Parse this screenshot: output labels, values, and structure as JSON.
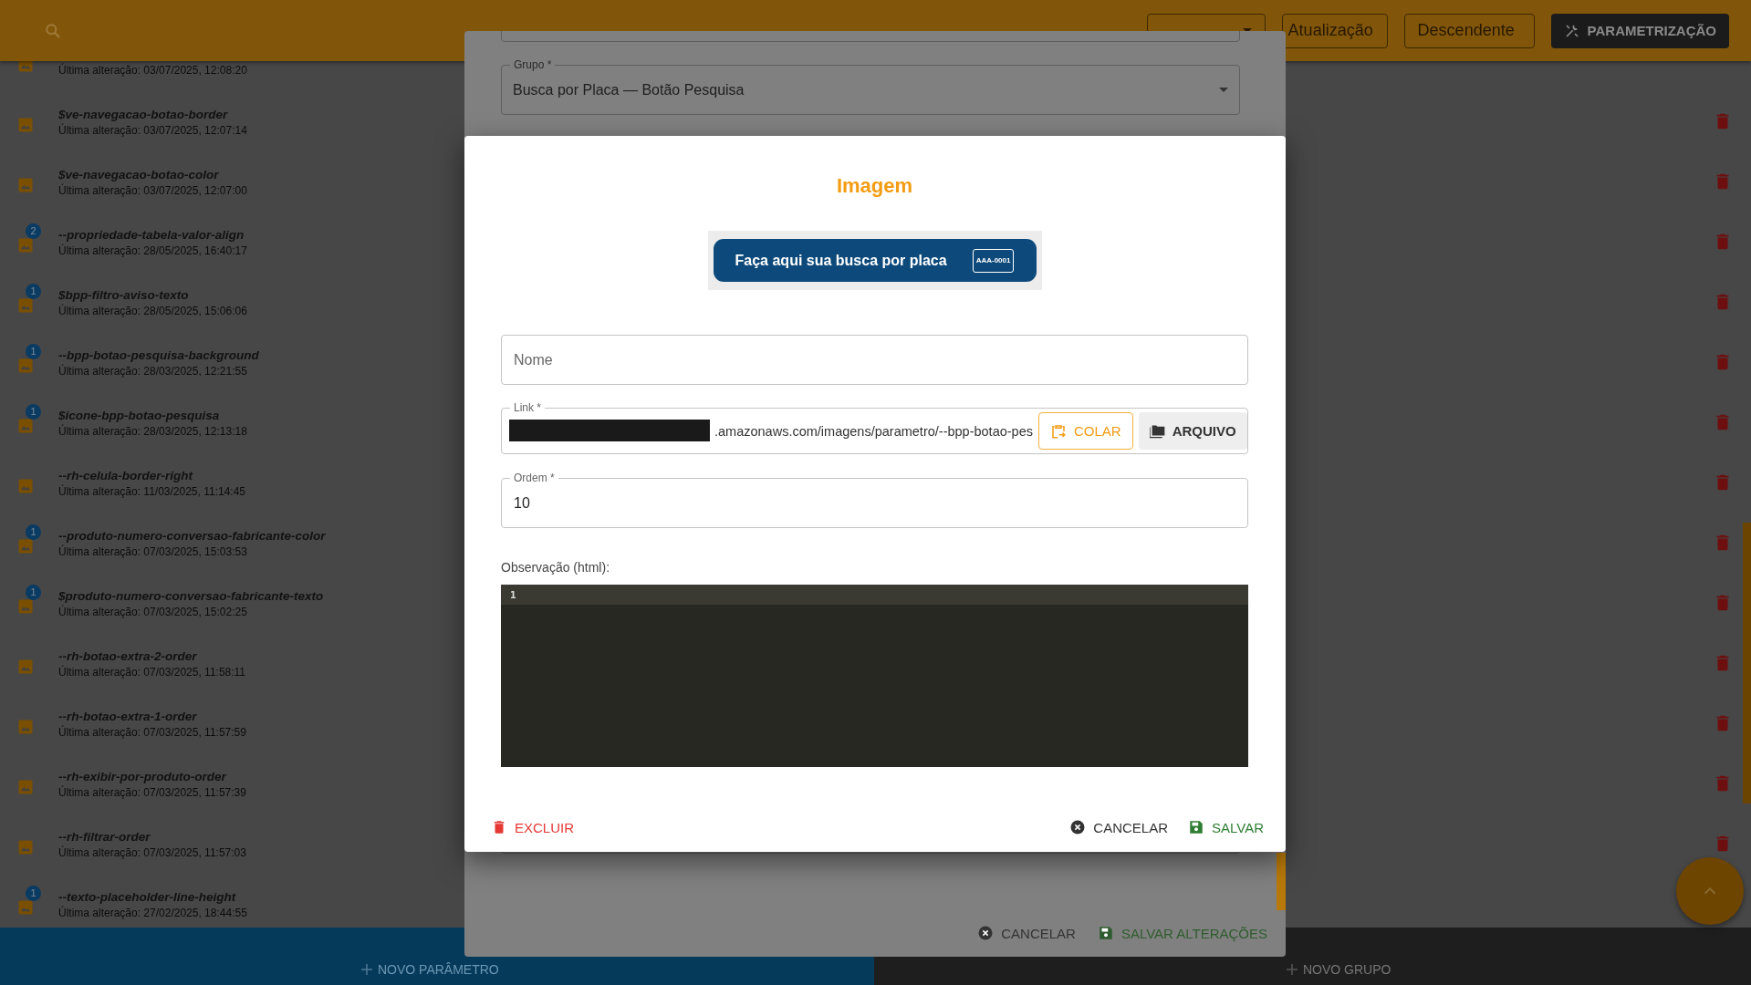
{
  "top_bar": {
    "filters": [
      {
        "value": "Atualização"
      },
      {
        "value": "Descendente"
      }
    ],
    "settings_button": "PARAMETRIZAÇÃO"
  },
  "parameters": [
    {
      "modified": "Última alteração: 03/07/2025, 12:08:20"
    },
    {
      "name": "$ve-navegacao-botao-border",
      "modified": "Última alteração: 03/07/2025, 12:07:14"
    },
    {
      "name": "$ve-navegacao-botao-color",
      "modified": "Última alteração: 03/07/2025, 12:07:00"
    },
    {
      "name": "--propriedade-tabela-valor-align",
      "modified": "Última alteração: 28/05/2025, 16:40:17",
      "badge": "2"
    },
    {
      "name": "$bpp-filtro-aviso-texto",
      "modified": "Última alteração: 28/05/2025, 15:06:06",
      "badge": "1"
    },
    {
      "name": "--bpp-botao-pesquisa-background",
      "modified": "Última alteração: 28/03/2025, 12:21:55",
      "badge": "1"
    },
    {
      "name": "$icone-bpp-botao-pesquisa",
      "modified": "Última alteração: 28/03/2025, 12:13:18",
      "badge": "1"
    },
    {
      "name": "--rh-celula-border-right",
      "modified": "Última alteração: 11/03/2025, 11:14:45"
    },
    {
      "name": "--produto-numero-conversao-fabricante-color",
      "modified": "Última alteração: 07/03/2025, 15:03:53",
      "badge": "1"
    },
    {
      "name": "$produto-numero-conversao-fabricante-texto",
      "modified": "Última alteração: 07/03/2025, 15:02:25",
      "badge": "1"
    },
    {
      "name": "--rh-botao-extra-2-order",
      "modified": "Última alteração: 07/03/2025, 11:58:11"
    },
    {
      "name": "--rh-botao-extra-1-order",
      "modified": "Última alteração: 07/03/2025, 11:57:59"
    },
    {
      "name": "--rh-exibir-por-produto-order",
      "modified": "Última alteração: 07/03/2025, 11:57:39"
    },
    {
      "name": "--rh-filtrar-order",
      "modified": "Última alteração: 07/03/2025, 11:57:03"
    },
    {
      "name": "--texto-placeholder-line-height",
      "modified": "Última alteração: 27/02/2025, 18:44:55",
      "badge": "1"
    }
  ],
  "bottom_bar": {
    "new_parameter": "NOVO PARÂMETRO",
    "new_group": "NOVO GRUPO"
  },
  "edit_dialog": {
    "group_field": {
      "label": "Grupo *",
      "value": "Busca por Placa — Botão Pesquisa"
    },
    "actions": [
      {
        "label": "CANCELAR",
        "kind": "cancel"
      },
      {
        "label": "SALVAR ALTERAÇÕES",
        "kind": "save"
      }
    ]
  },
  "image_dialog": {
    "title": "Imagem",
    "preview": {
      "text": "Faça aqui sua busca por placa",
      "plate": "AAA-0001"
    },
    "name_field": {
      "placeholder": "Nome"
    },
    "link_field": {
      "label": "Link *",
      "value": ".amazonaws.com/imagens/parametro/--bpp-botao-pes",
      "redacted": true
    },
    "link_buttons": [
      {
        "label": "COLAR",
        "kind": "paste"
      },
      {
        "label": "ARQUIVO",
        "kind": "file"
      }
    ],
    "order_field": {
      "label": "Ordem *",
      "value": "10"
    },
    "notes": {
      "label": "Observação (html):",
      "line_numbers": [
        "1"
      ]
    },
    "actions": [
      {
        "label": "EXCLUIR",
        "kind": "delete"
      },
      {
        "label": "CANCELAR",
        "kind": "cancel"
      },
      {
        "label": "SALVAR",
        "kind": "save"
      }
    ]
  }
}
